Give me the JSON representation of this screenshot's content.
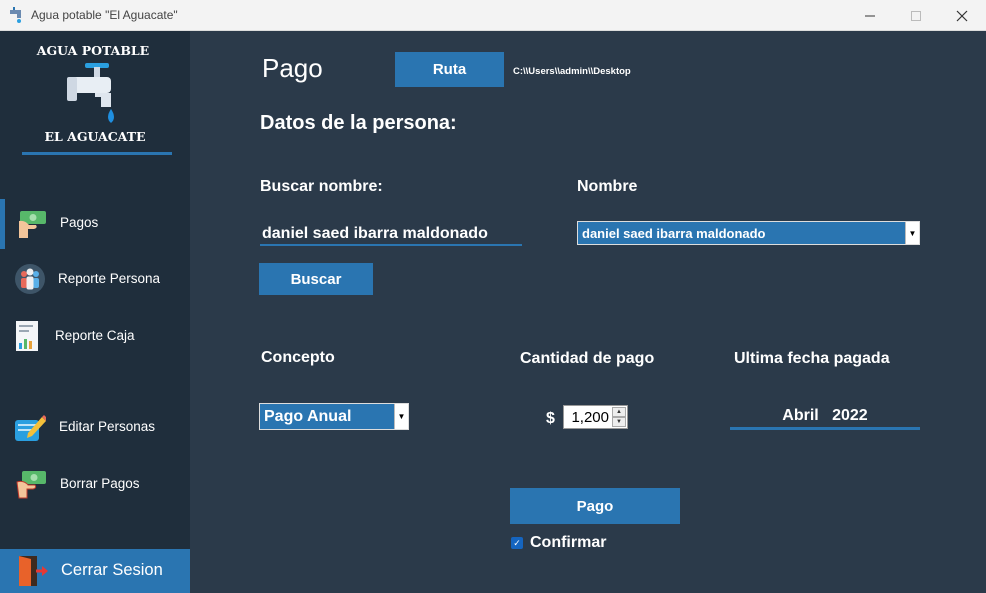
{
  "window": {
    "title": "Agua potable \"El Aguacate\""
  },
  "brand": {
    "top": "AGUA POTABLE",
    "bottom": "EL AGUACATE"
  },
  "sidebar": {
    "items": [
      {
        "label": "Pagos",
        "icon": "cash-hand-icon",
        "active": true
      },
      {
        "label": "Reporte Persona",
        "icon": "people-group-icon"
      },
      {
        "label": "Reporte Caja",
        "icon": "report-chart-icon"
      },
      {
        "label": "Editar Personas",
        "icon": "pencil-note-icon"
      },
      {
        "label": "Borrar Pagos",
        "icon": "money-hand-icon"
      }
    ],
    "logout": "Cerrar Sesion"
  },
  "main": {
    "title": "Pago",
    "route_button": "Ruta",
    "route_path": "C:\\\\Users\\\\admin\\\\Desktop",
    "section_title": "Datos de la persona:",
    "search_label": "Buscar nombre:",
    "search_value": "daniel saed ibarra maldonado",
    "name_label": "Nombre",
    "name_selected": "daniel saed ibarra maldonado",
    "search_button": "Buscar",
    "concept_label": "Concepto",
    "concept_selected": "Pago Anual",
    "amount_label": "Cantidad de pago",
    "currency": "$",
    "amount_value": "1,200",
    "last_date_label": "Ultima fecha pagada",
    "last_date_month": "Abril",
    "last_date_year": "2022",
    "pay_button": "Pago",
    "confirm_label": "Confirmar",
    "confirm_checked": true
  },
  "colors": {
    "accent": "#2a75b1",
    "sidebar": "#1f2e3c",
    "main": "#2b3a4a"
  }
}
